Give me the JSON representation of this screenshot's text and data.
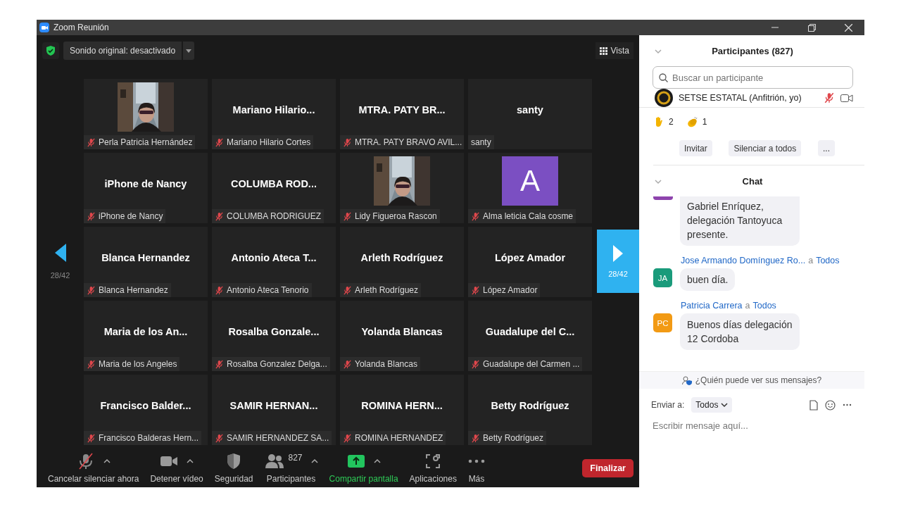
{
  "window": {
    "title": "Zoom Reunión"
  },
  "top_bar": {
    "original_sound": "Sonido original: desactivado",
    "view": "Vista"
  },
  "pager": {
    "left": "28/42",
    "right": "28/42"
  },
  "tiles": [
    {
      "kind": "picture",
      "label": "Perla Patricia Hernández",
      "muted": true
    },
    {
      "kind": "name",
      "title": "Mariano Hilario...",
      "label": "Mariano Hilario Cortes",
      "muted": true
    },
    {
      "kind": "name",
      "title": "MTRA. PATY BR...",
      "label": "MTRA. PATY BRAVO AVIL...",
      "muted": true
    },
    {
      "kind": "name",
      "title": "santy",
      "label": "santy",
      "muted": false
    },
    {
      "kind": "name",
      "title": "iPhone de Nancy",
      "label": "iPhone de Nancy",
      "muted": true
    },
    {
      "kind": "name",
      "title": "COLUMBA ROD...",
      "label": "COLUMBA RODRIGUEZ",
      "muted": true
    },
    {
      "kind": "picture",
      "label": "Lidy Figueroa Rascon",
      "muted": true
    },
    {
      "kind": "avatar",
      "letter": "A",
      "label": "Alma leticia Cala cosme",
      "muted": true
    },
    {
      "kind": "name",
      "title": "Blanca Hernandez",
      "label": "Blanca Hernandez",
      "muted": true
    },
    {
      "kind": "name",
      "title": "Antonio Ateca T...",
      "label": "Antonio Ateca Tenorio",
      "muted": true
    },
    {
      "kind": "name",
      "title": "Arleth Rodríguez",
      "label": "Arleth Rodríguez",
      "muted": true
    },
    {
      "kind": "name",
      "title": "López Amador",
      "label": "López Amador",
      "muted": true
    },
    {
      "kind": "name",
      "title": "Maria de los An...",
      "label": "Maria de los Angeles",
      "muted": true
    },
    {
      "kind": "name",
      "title": "Rosalba Gonzale...",
      "label": "Rosalba Gonzalez Delga...",
      "muted": true
    },
    {
      "kind": "name",
      "title": "Yolanda Blancas",
      "label": "Yolanda Blancas",
      "muted": true
    },
    {
      "kind": "name",
      "title": "Guadalupe del C...",
      "label": "Guadalupe del Carmen ...",
      "muted": true
    },
    {
      "kind": "name",
      "title": "Francisco Balder...",
      "label": "Francisco Balderas Hern...",
      "muted": true
    },
    {
      "kind": "name",
      "title": "SAMIR HERNAN...",
      "label": "SAMIR HERNANDEZ SA...",
      "muted": true
    },
    {
      "kind": "name",
      "title": "ROMINA HERN...",
      "label": "ROMINA HERNANDEZ",
      "muted": true
    },
    {
      "kind": "name",
      "title": "Betty Rodríguez",
      "label": "Betty Rodríguez",
      "muted": true
    }
  ],
  "toolbar": [
    {
      "kind": "mic",
      "label": "Cancelar silenciar ahora",
      "caret": true
    },
    {
      "kind": "video",
      "label": "Detener vídeo",
      "caret": true
    },
    {
      "kind": "shield",
      "label": "Seguridad",
      "caret": false
    },
    {
      "kind": "people",
      "label": "Participantes",
      "count": "827",
      "caret": true
    },
    {
      "kind": "share",
      "label": "Compartir pantalla",
      "caret": true
    },
    {
      "kind": "apps",
      "label": "Aplicaciones",
      "caret": false
    },
    {
      "kind": "more",
      "label": "Más",
      "caret": false
    }
  ],
  "end_button": "Finalizar",
  "participants": {
    "title": "Participantes (827)",
    "search": {
      "placeholder": "Buscar un participante"
    },
    "list": [
      {
        "name": "SETSE ESTATAL (Anfitrión, yo)",
        "muted": true
      }
    ],
    "reactions": [
      {
        "kind": "hand",
        "count": "2"
      },
      {
        "kind": "clap",
        "count": "1"
      }
    ],
    "buttons": [
      "Invitar",
      "Silenciar a todos",
      "..."
    ]
  },
  "chat": {
    "title": "Chat",
    "messages": [
      {
        "color": "#8e44ad",
        "text": "Gabriel Enríquez, delegación Tantoyuca presente."
      },
      {
        "sender": "Jose Armando Domínguez Ro...",
        "to_word": "a",
        "recipient": "Todos",
        "initials": "JA",
        "color": "#1a9b7b",
        "text": "buen día."
      },
      {
        "sender": "Patricia Carrera",
        "to_word": "a",
        "recipient": "Todos",
        "initials": "PC",
        "color": "#f29a14",
        "text": "Buenos días delegación 12 Cordoba"
      }
    ],
    "privacy": "¿Quién puede ver sus mensajes?",
    "send_to_label": "Enviar a:",
    "send_to": "Todos",
    "placeholder": "Escribir mensaje aquí..."
  }
}
